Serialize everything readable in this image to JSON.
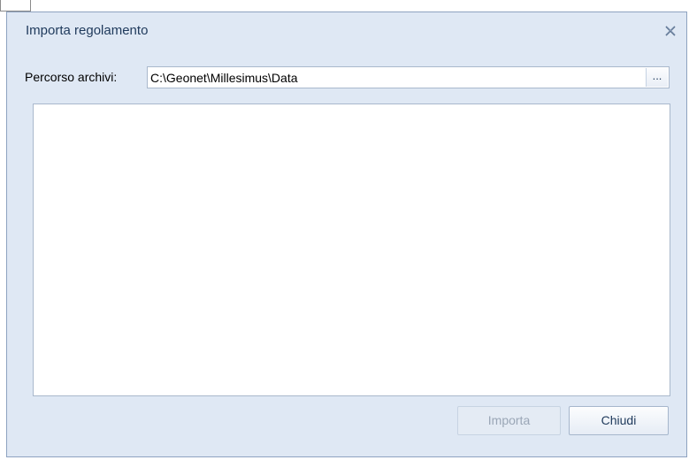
{
  "dialog": {
    "title": "Importa regolamento",
    "close_icon": "close-icon"
  },
  "path": {
    "label": "Percorso archivi:",
    "value": "C:\\Geonet\\Millesimus\\Data",
    "browse_label": "..."
  },
  "file_list": {
    "items": []
  },
  "buttons": {
    "import_label": "Importa",
    "import_enabled": false,
    "close_label": "Chiudi"
  },
  "colors": {
    "dialog_background": "#dfe8f4",
    "title_text": "#1e395b",
    "disabled_text": "#9aa6b6"
  }
}
